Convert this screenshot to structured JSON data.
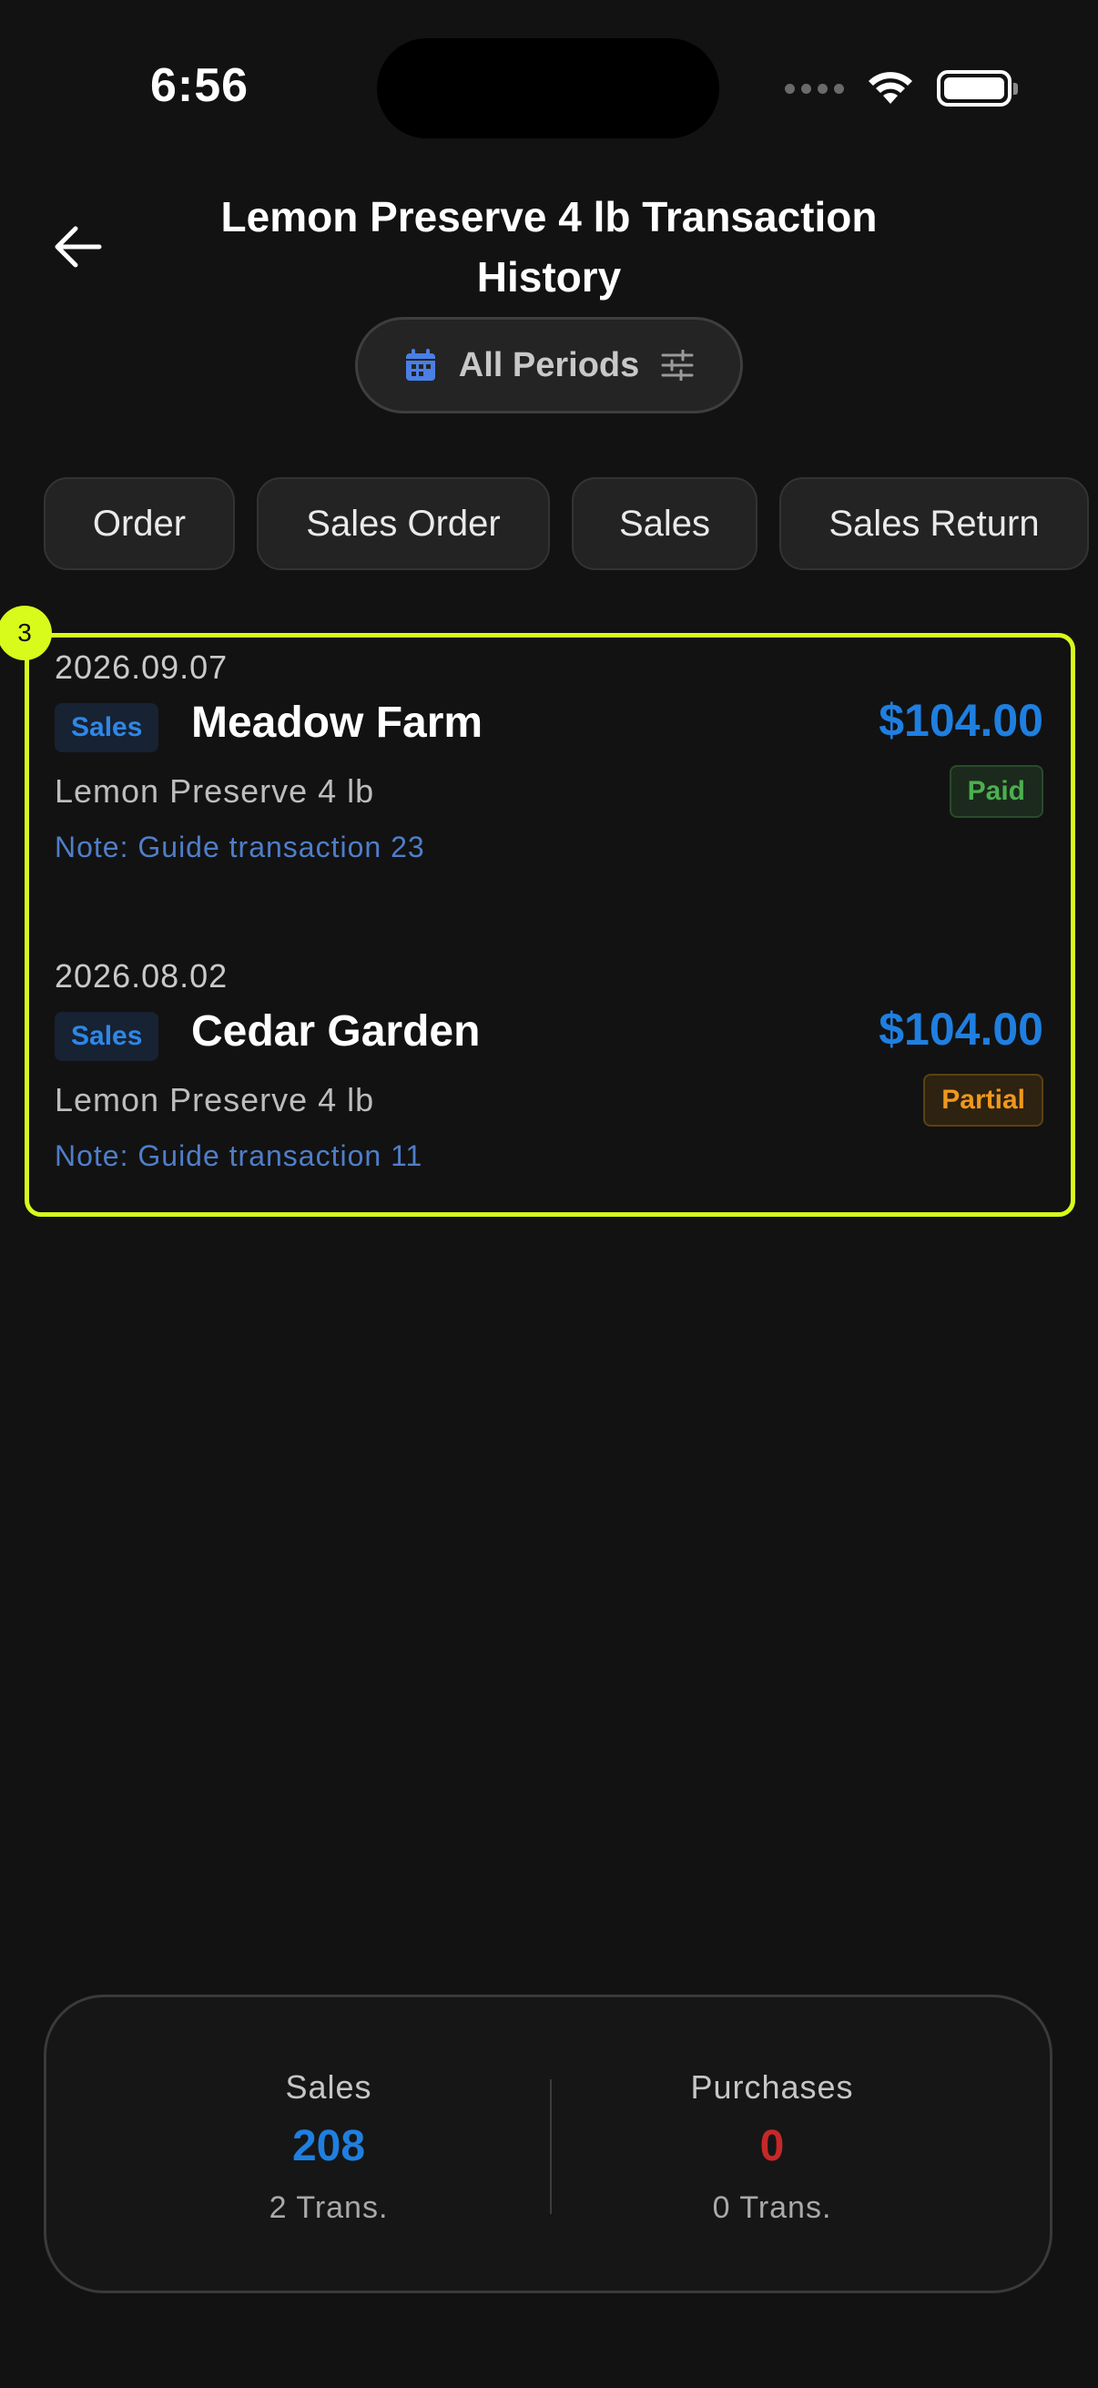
{
  "status_bar": {
    "time": "6:56"
  },
  "header": {
    "title": "Lemon Preserve 4 lb Transaction History"
  },
  "period_filter": {
    "label": "All Periods"
  },
  "filter_chips": [
    "Order",
    "Sales Order",
    "Sales",
    "Sales Return"
  ],
  "list": {
    "badge": "3",
    "transactions": [
      {
        "date": "2026.09.07",
        "type": "Sales",
        "customer": "Meadow Farm",
        "amount": "$104.00",
        "product": "Lemon Preserve 4 lb",
        "note": "Note: Guide transaction 23",
        "status": "Paid"
      },
      {
        "date": "2026.08.02",
        "type": "Sales",
        "customer": "Cedar Garden",
        "amount": "$104.00",
        "product": "Lemon Preserve 4 lb",
        "note": "Note: Guide transaction 11",
        "status": "Partial"
      }
    ]
  },
  "summary": {
    "sales": {
      "label": "Sales",
      "value": "208",
      "trans": "2 Trans.",
      "color": "#1f7fe0"
    },
    "purchases": {
      "label": "Purchases",
      "value": "0",
      "trans": "0 Trans.",
      "color": "#c62828"
    }
  },
  "colors": {
    "accent_blue": "#1f7fe0",
    "highlight": "#d8fb1b",
    "paid_green": "#4caf50",
    "partial_orange": "#f0981c"
  }
}
